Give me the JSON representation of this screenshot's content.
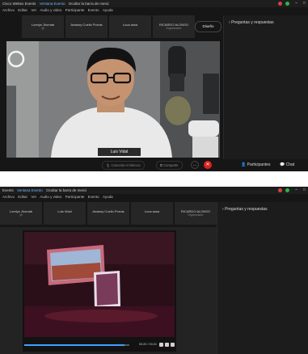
{
  "screen1": {
    "title_bar": {
      "app": "Cisco Webex Events",
      "events_window": "Ventana Evento",
      "hide_menu": "Ocultar la barra de menú"
    },
    "menu": [
      "Archivo",
      "Editar",
      "Ver",
      "Audio y video",
      "Participante",
      "Evento",
      "Ayuda"
    ],
    "participants_strip": [
      {
        "name": "Lorelys Jhomab",
        "sub": "@"
      },
      {
        "name": "Anaswy Cuello Porras",
        "sub": ""
      },
      {
        "name": "Luca assa",
        "sub": ""
      },
      {
        "name": "RICARDO ALONSO",
        "sub": "Organizador"
      }
    ],
    "stop_label": "Diseño",
    "right_panel_title": "Preguntas y respuestas",
    "video_name_tag": "Luis Vidal",
    "controls": {
      "unmute_label": "Cancelar el silencio",
      "share_label": "Compartir",
      "participants_label": "Participantes",
      "chat_label": "Chat"
    },
    "colors": {
      "end_call": "#e02020",
      "record": "#d94040",
      "status": "#2db24a"
    },
    "icons": [
      "mic-icon",
      "share-icon",
      "more-icon",
      "end-call-icon",
      "participants-icon",
      "chat-icon"
    ]
  },
  "screen2": {
    "title_bar": {
      "app": "Events",
      "events_window": "Ventana Evento",
      "hide_menu": "Ocultar la barra de menú"
    },
    "menu": [
      "Archivo",
      "Editar",
      "Ver",
      "Audio y video",
      "Participante",
      "Evento",
      "Ayuda"
    ],
    "participants_strip": [
      {
        "name": "Lorelys Jhomab",
        "sub": "@"
      },
      {
        "name": "Luis Vidal",
        "sub": ""
      },
      {
        "name": "Anaswy Cuello Porras",
        "sub": ""
      },
      {
        "name": "Luca assa",
        "sub": ""
      },
      {
        "name": "RICARDO ALONSO",
        "sub": "Organizador"
      }
    ],
    "right_panel_title": "Preguntas y respuestas",
    "media_time": "00:20 / 00:21",
    "media_progress": 0.95
  }
}
